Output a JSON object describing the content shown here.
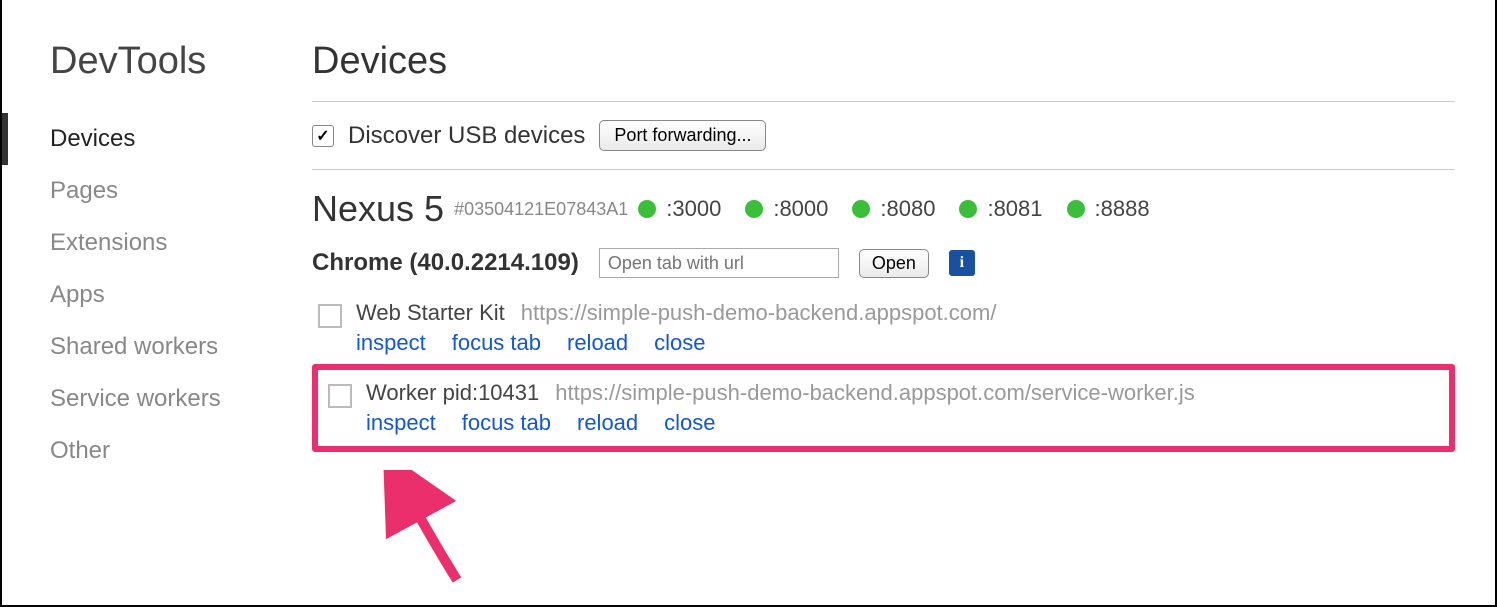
{
  "sidebar": {
    "brand": "DevTools",
    "items": [
      {
        "label": "Devices",
        "active": true
      },
      {
        "label": "Pages"
      },
      {
        "label": "Extensions"
      },
      {
        "label": "Apps"
      },
      {
        "label": "Shared workers"
      },
      {
        "label": "Service workers"
      },
      {
        "label": "Other"
      }
    ]
  },
  "page": {
    "title": "Devices",
    "discover_label": "Discover USB devices",
    "discover_checked": true,
    "port_forwarding_label": "Port forwarding..."
  },
  "device": {
    "name": "Nexus 5",
    "id": "#03504121E07843A1",
    "ports": [
      ":3000",
      ":8000",
      ":8080",
      ":8081",
      ":8888"
    ]
  },
  "browser": {
    "name": "Chrome (40.0.2214.109)",
    "url_placeholder": "Open tab with url",
    "open_label": "Open"
  },
  "targets": [
    {
      "title": "Web Starter Kit",
      "url": "https://simple-push-demo-backend.appspot.com/",
      "actions": [
        "inspect",
        "focus tab",
        "reload",
        "close"
      ],
      "highlighted": false
    },
    {
      "title": "Worker pid:10431",
      "url": "https://simple-push-demo-backend.appspot.com/service-worker.js",
      "actions": [
        "inspect",
        "focus tab",
        "reload",
        "close"
      ],
      "highlighted": true
    }
  ],
  "colors": {
    "link": "#1357d4",
    "port_dot": "#3bbf3b",
    "highlight": "#ea2f6c"
  }
}
